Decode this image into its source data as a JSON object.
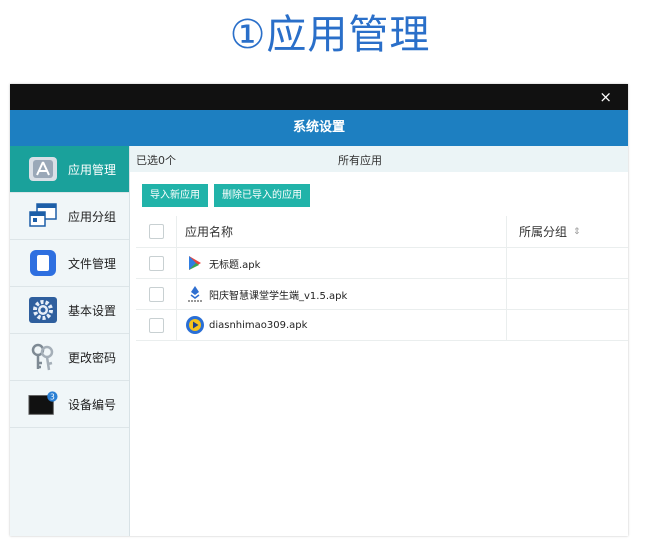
{
  "heading": "①应用管理",
  "window": {
    "close_symbol": "×",
    "title": "系统设置"
  },
  "sidebar": {
    "items": [
      {
        "label": "应用管理",
        "icon": "app-store-icon",
        "active": true
      },
      {
        "label": "应用分组",
        "icon": "windows-group-icon",
        "active": false
      },
      {
        "label": "文件管理",
        "icon": "file-icon",
        "active": false
      },
      {
        "label": "基本设置",
        "icon": "gear-icon",
        "active": false
      },
      {
        "label": "更改密码",
        "icon": "keys-icon",
        "active": false
      },
      {
        "label": "设备编号",
        "icon": "device-icon",
        "active": false,
        "badge": "3"
      }
    ]
  },
  "main": {
    "selected_count": "已选0个",
    "filter_label": "所有应用",
    "import_button": "导入新应用",
    "delete_button": "删除已导入的应用",
    "table": {
      "columns": [
        "应用名称",
        "所属分组"
      ],
      "sort_symbol": "⇕",
      "rows": [
        {
          "name": "无标题.apk",
          "icon": "play-store-icon",
          "group": ""
        },
        {
          "name": "阳庆智慧课堂学生端_v1.5.apk",
          "icon": "diamond-logo-icon",
          "group": ""
        },
        {
          "name": "diasnhimao309.apk",
          "icon": "video-player-icon",
          "group": ""
        }
      ]
    }
  },
  "colors": {
    "header_blue": "#1d7fc1",
    "active_teal": "#1aa19b",
    "button_teal": "#21b3a9",
    "heading_blue": "#2a6fc9"
  }
}
